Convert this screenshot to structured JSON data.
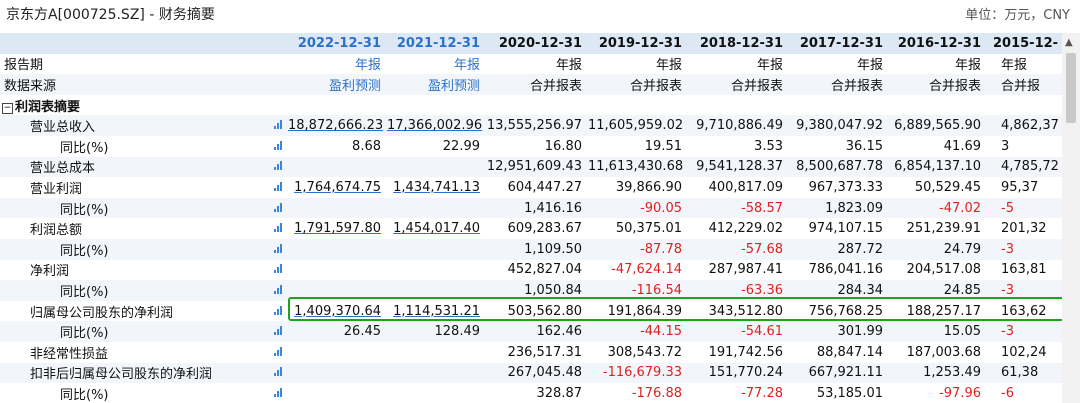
{
  "title": "京东方A[000725.SZ] - 财务摘要",
  "unit": "单位：万元，CNY",
  "colors": {
    "header_bg": "#dce8f4",
    "predicted_text": "#2b71c9",
    "negative_text": "#e02020",
    "highlight_border": "#1aa51a"
  },
  "columns": [
    "2022-12-31",
    "2021-12-31",
    "2020-12-31",
    "2019-12-31",
    "2018-12-31",
    "2017-12-31",
    "2016-12-31",
    "2015-12-"
  ],
  "rows": [
    {
      "label": "报告期",
      "indent": 0,
      "chart": false,
      "values": [
        "年报",
        "年报",
        "年报",
        "年报",
        "年报",
        "年报",
        "年报",
        "年报"
      ]
    },
    {
      "label": "数据来源",
      "indent": 0,
      "chart": false,
      "values": [
        "盈利预测",
        "盈利预测",
        "合并报表",
        "合并报表",
        "合并报表",
        "合并报表",
        "合并报表",
        "合并报"
      ]
    },
    {
      "label": "利润表摘要",
      "indent": 0,
      "section": true,
      "chart": false,
      "values": [
        "",
        "",
        "",
        "",
        "",
        "",
        "",
        ""
      ]
    },
    {
      "label": "营业总收入",
      "indent": 1,
      "chart": true,
      "values": [
        "18,872,666.23",
        "17,366,002.96",
        "13,555,256.97",
        "11,605,959.02",
        "9,710,886.49",
        "9,380,047.92",
        "6,889,565.90",
        "4,862,37"
      ]
    },
    {
      "label": "同比(%)",
      "indent": 2,
      "chart": true,
      "values": [
        "8.68",
        "22.99",
        "16.80",
        "19.51",
        "3.53",
        "36.15",
        "41.69",
        "3"
      ]
    },
    {
      "label": "营业总成本",
      "indent": 1,
      "chart": true,
      "values": [
        "",
        "",
        "12,951,609.43",
        "11,613,430.68",
        "9,541,128.37",
        "8,500,687.78",
        "6,854,137.10",
        "4,785,72"
      ]
    },
    {
      "label": "营业利润",
      "indent": 1,
      "chart": true,
      "values": [
        "1,764,674.75",
        "1,434,741.13",
        "604,447.27",
        "39,866.90",
        "400,817.09",
        "967,373.33",
        "50,529.45",
        "95,37"
      ]
    },
    {
      "label": "同比(%)",
      "indent": 2,
      "chart": true,
      "values": [
        "",
        "",
        "1,416.16",
        "-90.05",
        "-58.57",
        "1,823.09",
        "-47.02",
        "-5"
      ]
    },
    {
      "label": "利润总额",
      "indent": 1,
      "chart": true,
      "values": [
        "1,791,597.80",
        "1,454,017.40",
        "609,283.67",
        "50,375.01",
        "412,229.02",
        "974,107.15",
        "251,239.91",
        "201,32"
      ]
    },
    {
      "label": "同比(%)",
      "indent": 2,
      "chart": true,
      "values": [
        "",
        "",
        "1,109.50",
        "-87.78",
        "-57.68",
        "287.72",
        "24.79",
        "-3"
      ]
    },
    {
      "label": "净利润",
      "indent": 1,
      "chart": true,
      "values": [
        "",
        "",
        "452,827.04",
        "-47,624.14",
        "287,987.41",
        "786,041.16",
        "204,517.08",
        "163,81"
      ]
    },
    {
      "label": "同比(%)",
      "indent": 2,
      "chart": true,
      "values": [
        "",
        "",
        "1,050.84",
        "-116.54",
        "-63.36",
        "284.34",
        "24.85",
        "-3"
      ]
    },
    {
      "label": "归属母公司股东的净利润",
      "indent": 1,
      "chart": true,
      "values": [
        "1,409,370.64",
        "1,114,531.21",
        "503,562.80",
        "191,864.39",
        "343,512.80",
        "756,768.25",
        "188,257.17",
        "163,62"
      ]
    },
    {
      "label": "同比(%)",
      "indent": 2,
      "chart": true,
      "values": [
        "26.45",
        "128.49",
        "162.46",
        "-44.15",
        "-54.61",
        "301.99",
        "15.05",
        "-3"
      ]
    },
    {
      "label": "非经常性损益",
      "indent": 1,
      "chart": true,
      "values": [
        "",
        "",
        "236,517.31",
        "308,543.72",
        "191,742.56",
        "88,847.14",
        "187,003.68",
        "102,24"
      ]
    },
    {
      "label": "扣非后归属母公司股东的净利润",
      "indent": 1,
      "chart": true,
      "values": [
        "",
        "",
        "267,045.48",
        "-116,679.33",
        "151,770.24",
        "667,921.11",
        "1,253.49",
        "61,38"
      ]
    },
    {
      "label": "同比(%)",
      "indent": 2,
      "chart": true,
      "values": [
        "",
        "",
        "328.87",
        "-176.88",
        "-77.28",
        "53,185.01",
        "-97.96",
        "-6"
      ]
    }
  ]
}
